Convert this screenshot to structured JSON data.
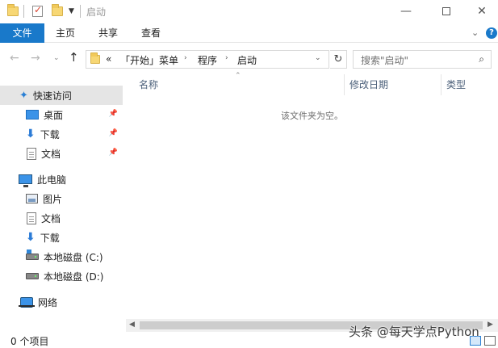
{
  "window": {
    "title": "启动"
  },
  "ribbon": {
    "tabs": [
      {
        "label": "文件"
      },
      {
        "label": "主页"
      },
      {
        "label": "共享"
      },
      {
        "label": "查看"
      }
    ]
  },
  "address": {
    "crumbs": [
      "«",
      "「开始」菜单",
      "程序",
      "启动"
    ]
  },
  "search": {
    "placeholder": "搜索\"启动\""
  },
  "sidebar": {
    "quick_access": "快速访问",
    "quick_items": [
      "桌面",
      "下载",
      "文档"
    ],
    "this_pc": "此电脑",
    "pc_items": [
      "图片",
      "文档",
      "下载",
      "本地磁盘 (C:)",
      "本地磁盘 (D:)"
    ],
    "network": "网络"
  },
  "columns": [
    "名称",
    "修改日期",
    "类型"
  ],
  "content": {
    "empty_message": "该文件夹为空。"
  },
  "status": {
    "item_count": "0 个项目"
  },
  "watermark": "头条 @每天学点Python"
}
